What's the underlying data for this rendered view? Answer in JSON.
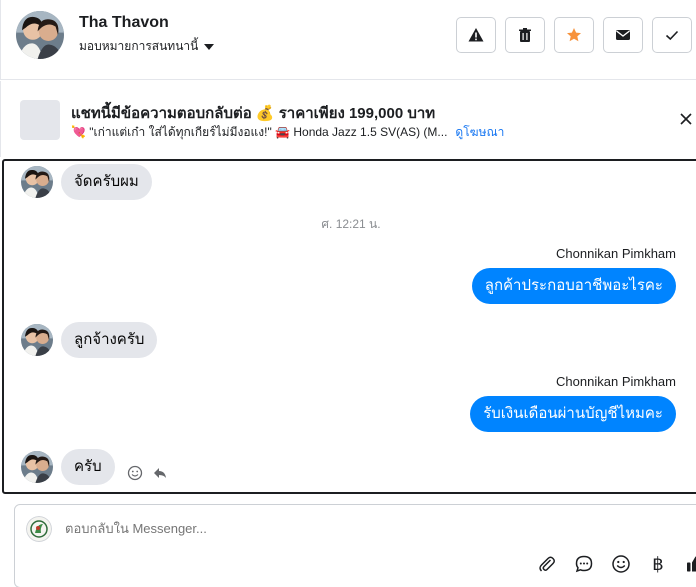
{
  "header": {
    "contact_name": "Tha Thavon",
    "assign_label": "มอบหมายการสนทนานี้",
    "actions": [
      {
        "name": "report-button",
        "icon": "warning-icon"
      },
      {
        "name": "delete-button",
        "icon": "trash-icon"
      },
      {
        "name": "star-button",
        "icon": "star-icon",
        "color": "#f7923b"
      },
      {
        "name": "mark-unread-button",
        "icon": "envelope-icon"
      },
      {
        "name": "mark-done-button",
        "icon": "check-icon"
      }
    ]
  },
  "ad": {
    "title": "แชทนี้มีข้อความตอบกลับต่อ 💰 ราคาเพียง 199,000 บาท",
    "subtitle": "💘 \"เก่าแต่เก๋า ใส่ได้ทุกเกียร์ไม่มีงอแง!\" 🚘 Honda Jazz 1.5 SV(AS) (M...",
    "link": "ดูโฆษณา"
  },
  "messages": [
    {
      "direction": "in",
      "text": "จัดครับผม"
    },
    {
      "timestamp": "ศ. 12:21 น."
    },
    {
      "direction": "out",
      "sender": "Chonnikan Pimkham",
      "text": "ลูกค้าประกอบอาชีพอะไรคะ"
    },
    {
      "direction": "in",
      "text": "ลูกจ้างครับ"
    },
    {
      "direction": "out",
      "sender": "Chonnikan Pimkham",
      "text": "รับเงินเดือนผ่านบัญชีไหมคะ"
    },
    {
      "direction": "in",
      "text": "ครับ"
    }
  ],
  "composer": {
    "placeholder": "ตอบกลับใน Messenger...",
    "tools": [
      "paperclip-icon",
      "chat-bubble-icon",
      "emoji-icon",
      "baht-icon",
      "thumbs-up-icon"
    ]
  },
  "colors": {
    "outgoing_bubble": "#0084ff",
    "incoming_bubble": "#e4e6eb",
    "star": "#f7923b",
    "link": "#1877f2"
  }
}
